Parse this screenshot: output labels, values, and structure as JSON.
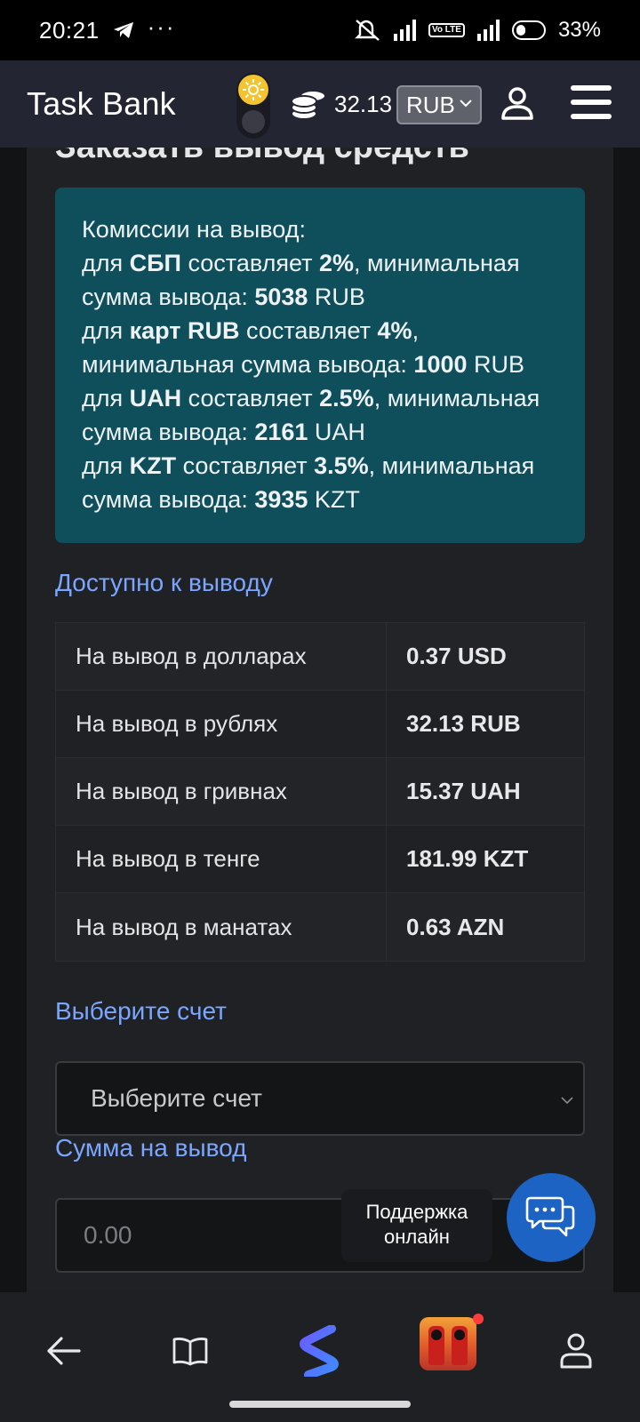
{
  "status_bar": {
    "time": "20:21",
    "dots": "···",
    "volte": "Vo LTE",
    "battery": "33%"
  },
  "header": {
    "brand": "Task Bank",
    "balance": "32.13",
    "currency": "RUB"
  },
  "page": {
    "title": "Заказать вывод средств"
  },
  "commission": {
    "intro": "Комиссии на вывод:",
    "lines": [
      {
        "pre": "для ",
        "method": "СБП",
        "mid": " составляет ",
        "rate": "2%",
        "post": ", минимальная сумма вывода: ",
        "min": "5038",
        "cur": " RUB"
      },
      {
        "pre": "для ",
        "method": "карт RUB",
        "mid": " составляет ",
        "rate": "4%",
        "post": ", минимальная сумма вывода: ",
        "min": "1000",
        "cur": " RUB"
      },
      {
        "pre": "для ",
        "method": "UAH",
        "mid": " составляет ",
        "rate": "2.5%",
        "post": ", минимальная сумма вывода: ",
        "min": "2161",
        "cur": " UAH"
      },
      {
        "pre": "для ",
        "method": "KZT",
        "mid": " составляет ",
        "rate": "3.5%",
        "post": ", минимальная сумма вывода: ",
        "min": "3935",
        "cur": " KZT"
      }
    ]
  },
  "available": {
    "label": "Доступно к выводу",
    "rows": [
      {
        "name": "На вывод в долларах",
        "value": "0.37 USD"
      },
      {
        "name": "На вывод в рублях",
        "value": "32.13 RUB"
      },
      {
        "name": "На вывод в гривнах",
        "value": "15.37 UAH"
      },
      {
        "name": "На вывод в тенге",
        "value": "181.99 KZT"
      },
      {
        "name": "На вывод в манатах",
        "value": "0.63 AZN"
      }
    ]
  },
  "account": {
    "label": "Выберите счет",
    "selected": "Выберите счет"
  },
  "amount": {
    "label": "Сумма на вывод",
    "placeholder": "0.00"
  },
  "support": {
    "line1": "Поддержка",
    "line2": "онлайн"
  },
  "colors": {
    "accent": "#7aa6ff",
    "info_box": "#0f4f5c",
    "support": "#1d63c4",
    "header": "#242532"
  }
}
